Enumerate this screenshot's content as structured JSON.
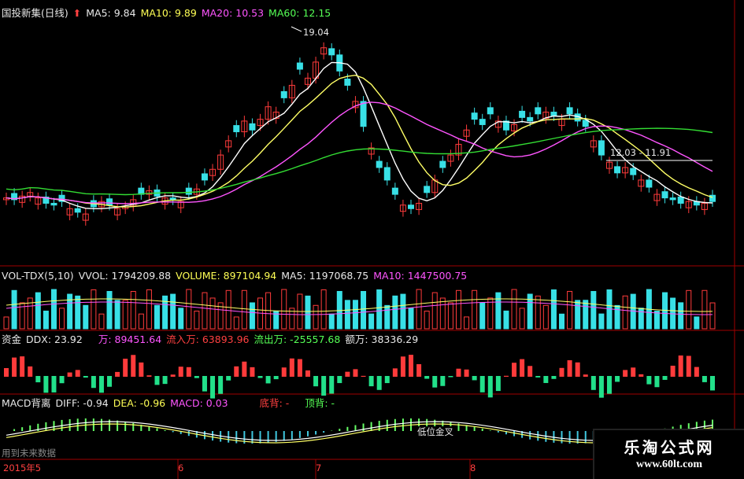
{
  "header": {
    "title": "国投新集(日线)",
    "ma5": "MA5: 9.84",
    "ma10": "MA10: 9.89",
    "ma20": "MA20: 10.53",
    "ma60": "MA60: 12.15"
  },
  "price_panel": {
    "high_label": "19.04",
    "range_label": "12.03 - 11.91"
  },
  "volume_panel": {
    "title": "VOL-TDX(5,10)",
    "vvol": "VVOL: 1794209.88",
    "volume": "VOLUME: 897104.94",
    "ma5": "MA5: 1197068.75",
    "ma10": "MA10: 1447500.75"
  },
  "fund_panel": {
    "title": "资金",
    "ddx": "DDX: 23.92",
    "wan": "万: 89451.64",
    "inflow": "流入万: 63893.96",
    "outflow": "流出万: -25557.68",
    "amount": "额万: 38336.29"
  },
  "macd_panel": {
    "title": "MACD背离",
    "diff": "DIFF: -0.94",
    "dea": "DEA: -0.96",
    "macd": "MACD: 0.03",
    "bottom_div": "底背: -",
    "top_div": "顶背: -",
    "cross_label": "低位金叉",
    "note": "用到未来数据"
  },
  "time_axis": {
    "labels": [
      "2015年5",
      "6",
      "7",
      "8"
    ]
  },
  "watermark": {
    "line1": "乐淘公式网",
    "line2": "www.60lt.com"
  },
  "colors": {
    "up": "#ff3b3b",
    "down": "#38e0e6",
    "ma5": "#ffffff",
    "ma10": "#ffff66",
    "ma20": "#ff55ff",
    "ma60": "#33dd33",
    "panel_border": "#a00000"
  },
  "chart_data": {
    "type": "candlestick",
    "title": "国投新集(日线)",
    "y_high_marker": 19.04,
    "ma_latest": {
      "MA5": 9.84,
      "MA10": 9.89,
      "MA20": 10.53,
      "MA60": 12.15
    },
    "close_series": [
      10.2,
      10.1,
      10.3,
      10.5,
      10.2,
      9.9,
      9.8,
      10.0,
      9.6,
      9.4,
      9.3,
      9.7,
      10.0,
      9.8,
      9.6,
      9.7,
      10.1,
      10.4,
      10.6,
      10.3,
      10.2,
      10.1,
      10.0,
      10.4,
      10.7,
      11.2,
      11.8,
      12.6,
      13.4,
      13.9,
      14.5,
      14.0,
      14.6,
      15.3,
      15.0,
      15.8,
      16.5,
      17.4,
      16.9,
      17.8,
      18.6,
      18.2,
      17.3,
      16.5,
      15.6,
      14.2,
      13.0,
      11.9,
      11.2,
      10.4,
      9.8,
      9.6,
      9.9,
      10.5,
      11.2,
      11.9,
      12.6,
      13.2,
      14.0,
      14.6,
      14.3,
      14.9,
      14.5,
      14.0,
      14.3,
      14.7,
      14.5,
      14.9,
      15.0,
      14.8,
      14.6,
      14.9,
      14.5,
      14.2,
      13.4,
      12.6,
      12.2,
      11.6,
      11.9,
      11.5,
      11.2,
      10.8,
      10.4,
      10.2,
      10.1,
      9.9,
      10.0,
      9.8,
      9.9,
      10.0
    ],
    "vvol": 1794209.88,
    "volume": 897104.94,
    "vol_ma5": 1197068.75,
    "vol_ma10": 1447500.75,
    "ddx": 23.92,
    "fund_wan": 89451.64,
    "fund_inflow": 63893.96,
    "fund_outflow": -25557.68,
    "fund_amount": 38336.29,
    "macd_diff": -0.94,
    "macd_dea": -0.96,
    "macd": 0.03,
    "x_labels": [
      "2015年5",
      "6",
      "7",
      "8"
    ]
  }
}
